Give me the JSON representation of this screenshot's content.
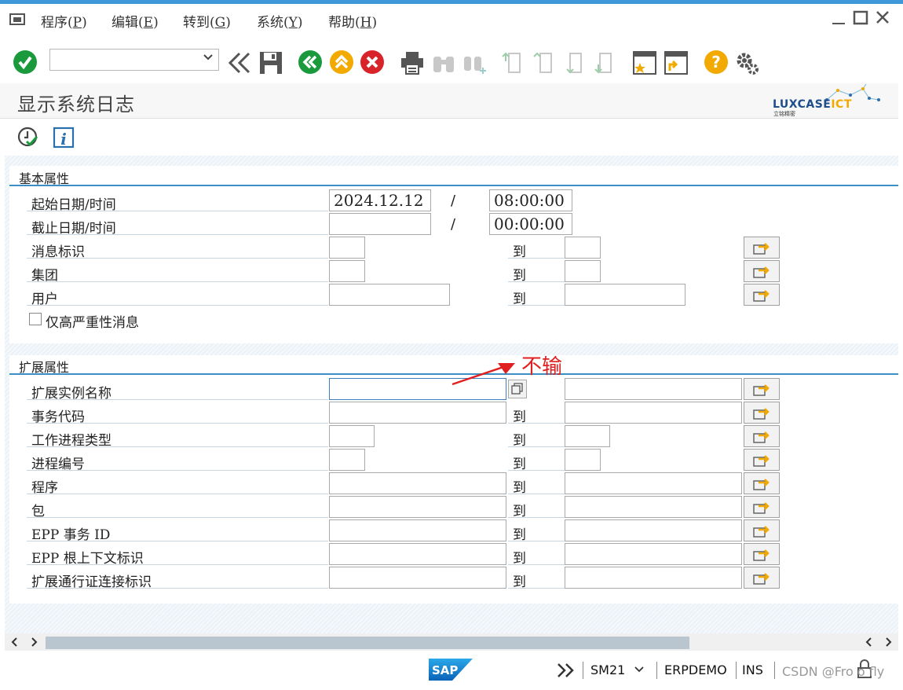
{
  "menu": {
    "program": "程序(",
    "program_key": "P",
    "edit": "编辑(",
    "edit_key": "E",
    "goto": "转到(",
    "goto_key": "G",
    "system": "系统(",
    "system_key": "Y",
    "help": "帮助(",
    "help_key": "H",
    "close_paren": ")"
  },
  "page": {
    "title": "显示系统日志"
  },
  "logo": {
    "text_main": "LUXCASE",
    "text_accent": "ICT",
    "subtitle": "立铭精密"
  },
  "basic_group": {
    "title": "基本属性",
    "rows": [
      {
        "label": "起始日期/时间",
        "from": "2024.12.12",
        "to": "08:00:00"
      },
      {
        "label": "截止日期/时间",
        "from": "",
        "to": "00:00:00"
      },
      {
        "label": "消息标识",
        "from": "",
        "to": ""
      },
      {
        "label": "集团",
        "from": "",
        "to": ""
      },
      {
        "label": "用户",
        "from": "",
        "to": ""
      }
    ],
    "checkbox_label": "仅高严重性消息"
  },
  "to_label": "到",
  "slash": "/",
  "extended_group": {
    "title": "扩展属性",
    "rows": [
      {
        "label": "扩展实例名称"
      },
      {
        "label": "事务代码"
      },
      {
        "label": "工作进程类型"
      },
      {
        "label": "进程编号"
      },
      {
        "label": "程序"
      },
      {
        "label": "包"
      },
      {
        "label": "EPP 事务 ID"
      },
      {
        "label": "EPP 根上下文标识"
      },
      {
        "label": "扩展通行证连接标识"
      }
    ]
  },
  "annotation": "不输",
  "status": {
    "transaction": "SM21",
    "system": "ERPDEMO",
    "mode": "INS",
    "watermark": "CSDN @Fro o fly"
  },
  "colors": {
    "accent": "#3a8fc5",
    "ok_green": "#1a9a3c",
    "cancel_red": "#d9232a",
    "warn_yellow": "#f2a900",
    "annotation_red": "#e02020"
  }
}
